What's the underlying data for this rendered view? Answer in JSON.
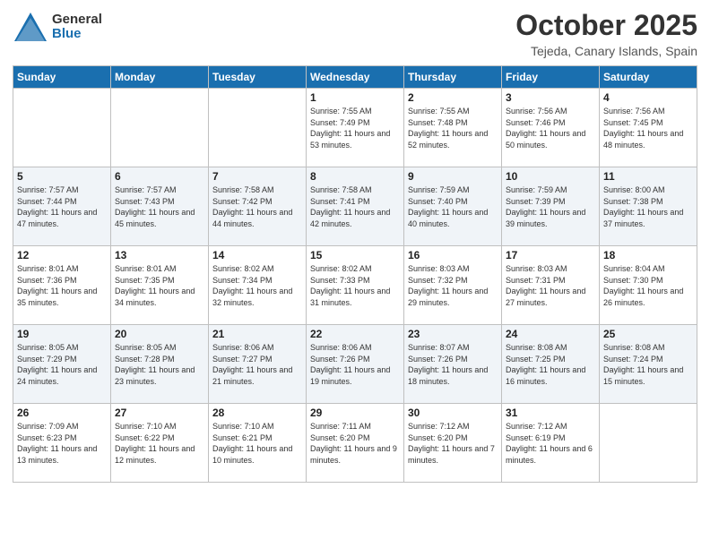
{
  "logo": {
    "general": "General",
    "blue": "Blue"
  },
  "header": {
    "month": "October 2025",
    "location": "Tejeda, Canary Islands, Spain"
  },
  "weekdays": [
    "Sunday",
    "Monday",
    "Tuesday",
    "Wednesday",
    "Thursday",
    "Friday",
    "Saturday"
  ],
  "weeks": [
    [
      {
        "day": "",
        "sunrise": "",
        "sunset": "",
        "daylight": ""
      },
      {
        "day": "",
        "sunrise": "",
        "sunset": "",
        "daylight": ""
      },
      {
        "day": "",
        "sunrise": "",
        "sunset": "",
        "daylight": ""
      },
      {
        "day": "1",
        "sunrise": "Sunrise: 7:55 AM",
        "sunset": "Sunset: 7:49 PM",
        "daylight": "Daylight: 11 hours and 53 minutes."
      },
      {
        "day": "2",
        "sunrise": "Sunrise: 7:55 AM",
        "sunset": "Sunset: 7:48 PM",
        "daylight": "Daylight: 11 hours and 52 minutes."
      },
      {
        "day": "3",
        "sunrise": "Sunrise: 7:56 AM",
        "sunset": "Sunset: 7:46 PM",
        "daylight": "Daylight: 11 hours and 50 minutes."
      },
      {
        "day": "4",
        "sunrise": "Sunrise: 7:56 AM",
        "sunset": "Sunset: 7:45 PM",
        "daylight": "Daylight: 11 hours and 48 minutes."
      }
    ],
    [
      {
        "day": "5",
        "sunrise": "Sunrise: 7:57 AM",
        "sunset": "Sunset: 7:44 PM",
        "daylight": "Daylight: 11 hours and 47 minutes."
      },
      {
        "day": "6",
        "sunrise": "Sunrise: 7:57 AM",
        "sunset": "Sunset: 7:43 PM",
        "daylight": "Daylight: 11 hours and 45 minutes."
      },
      {
        "day": "7",
        "sunrise": "Sunrise: 7:58 AM",
        "sunset": "Sunset: 7:42 PM",
        "daylight": "Daylight: 11 hours and 44 minutes."
      },
      {
        "day": "8",
        "sunrise": "Sunrise: 7:58 AM",
        "sunset": "Sunset: 7:41 PM",
        "daylight": "Daylight: 11 hours and 42 minutes."
      },
      {
        "day": "9",
        "sunrise": "Sunrise: 7:59 AM",
        "sunset": "Sunset: 7:40 PM",
        "daylight": "Daylight: 11 hours and 40 minutes."
      },
      {
        "day": "10",
        "sunrise": "Sunrise: 7:59 AM",
        "sunset": "Sunset: 7:39 PM",
        "daylight": "Daylight: 11 hours and 39 minutes."
      },
      {
        "day": "11",
        "sunrise": "Sunrise: 8:00 AM",
        "sunset": "Sunset: 7:38 PM",
        "daylight": "Daylight: 11 hours and 37 minutes."
      }
    ],
    [
      {
        "day": "12",
        "sunrise": "Sunrise: 8:01 AM",
        "sunset": "Sunset: 7:36 PM",
        "daylight": "Daylight: 11 hours and 35 minutes."
      },
      {
        "day": "13",
        "sunrise": "Sunrise: 8:01 AM",
        "sunset": "Sunset: 7:35 PM",
        "daylight": "Daylight: 11 hours and 34 minutes."
      },
      {
        "day": "14",
        "sunrise": "Sunrise: 8:02 AM",
        "sunset": "Sunset: 7:34 PM",
        "daylight": "Daylight: 11 hours and 32 minutes."
      },
      {
        "day": "15",
        "sunrise": "Sunrise: 8:02 AM",
        "sunset": "Sunset: 7:33 PM",
        "daylight": "Daylight: 11 hours and 31 minutes."
      },
      {
        "day": "16",
        "sunrise": "Sunrise: 8:03 AM",
        "sunset": "Sunset: 7:32 PM",
        "daylight": "Daylight: 11 hours and 29 minutes."
      },
      {
        "day": "17",
        "sunrise": "Sunrise: 8:03 AM",
        "sunset": "Sunset: 7:31 PM",
        "daylight": "Daylight: 11 hours and 27 minutes."
      },
      {
        "day": "18",
        "sunrise": "Sunrise: 8:04 AM",
        "sunset": "Sunset: 7:30 PM",
        "daylight": "Daylight: 11 hours and 26 minutes."
      }
    ],
    [
      {
        "day": "19",
        "sunrise": "Sunrise: 8:05 AM",
        "sunset": "Sunset: 7:29 PM",
        "daylight": "Daylight: 11 hours and 24 minutes."
      },
      {
        "day": "20",
        "sunrise": "Sunrise: 8:05 AM",
        "sunset": "Sunset: 7:28 PM",
        "daylight": "Daylight: 11 hours and 23 minutes."
      },
      {
        "day": "21",
        "sunrise": "Sunrise: 8:06 AM",
        "sunset": "Sunset: 7:27 PM",
        "daylight": "Daylight: 11 hours and 21 minutes."
      },
      {
        "day": "22",
        "sunrise": "Sunrise: 8:06 AM",
        "sunset": "Sunset: 7:26 PM",
        "daylight": "Daylight: 11 hours and 19 minutes."
      },
      {
        "day": "23",
        "sunrise": "Sunrise: 8:07 AM",
        "sunset": "Sunset: 7:26 PM",
        "daylight": "Daylight: 11 hours and 18 minutes."
      },
      {
        "day": "24",
        "sunrise": "Sunrise: 8:08 AM",
        "sunset": "Sunset: 7:25 PM",
        "daylight": "Daylight: 11 hours and 16 minutes."
      },
      {
        "day": "25",
        "sunrise": "Sunrise: 8:08 AM",
        "sunset": "Sunset: 7:24 PM",
        "daylight": "Daylight: 11 hours and 15 minutes."
      }
    ],
    [
      {
        "day": "26",
        "sunrise": "Sunrise: 7:09 AM",
        "sunset": "Sunset: 6:23 PM",
        "daylight": "Daylight: 11 hours and 13 minutes."
      },
      {
        "day": "27",
        "sunrise": "Sunrise: 7:10 AM",
        "sunset": "Sunset: 6:22 PM",
        "daylight": "Daylight: 11 hours and 12 minutes."
      },
      {
        "day": "28",
        "sunrise": "Sunrise: 7:10 AM",
        "sunset": "Sunset: 6:21 PM",
        "daylight": "Daylight: 11 hours and 10 minutes."
      },
      {
        "day": "29",
        "sunrise": "Sunrise: 7:11 AM",
        "sunset": "Sunset: 6:20 PM",
        "daylight": "Daylight: 11 hours and 9 minutes."
      },
      {
        "day": "30",
        "sunrise": "Sunrise: 7:12 AM",
        "sunset": "Sunset: 6:20 PM",
        "daylight": "Daylight: 11 hours and 7 minutes."
      },
      {
        "day": "31",
        "sunrise": "Sunrise: 7:12 AM",
        "sunset": "Sunset: 6:19 PM",
        "daylight": "Daylight: 11 hours and 6 minutes."
      },
      {
        "day": "",
        "sunrise": "",
        "sunset": "",
        "daylight": ""
      }
    ]
  ]
}
